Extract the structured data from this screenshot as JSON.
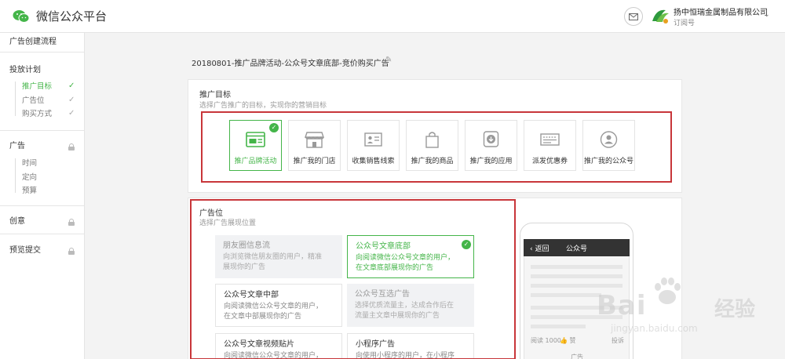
{
  "app": {
    "title": "微信公众平台"
  },
  "account": {
    "name": "扬中恒瑞金属制品有限公司",
    "type": "订阅号"
  },
  "sidebar": {
    "sections": [
      {
        "label": "广告创建流程"
      },
      {
        "label": "投放计划",
        "items": [
          {
            "label": "推广目标",
            "active": true
          },
          {
            "label": "广告位"
          },
          {
            "label": "购买方式"
          }
        ]
      },
      {
        "label": "广告",
        "items": [
          {
            "label": "时间"
          },
          {
            "label": "定向"
          },
          {
            "label": "预算"
          }
        ]
      },
      {
        "label": "创意"
      },
      {
        "label": "预览提交"
      }
    ]
  },
  "plan": {
    "title": "20180801-推广品牌活动-公众号文章底部-竞价购买广告"
  },
  "goal_section": {
    "title": "推广目标",
    "subtitle": "选择广告推广的目标，实现你的营销目标",
    "options": [
      {
        "label": "推广品牌活动",
        "icon": "brand-activity-icon",
        "selected": true
      },
      {
        "label": "推广我的门店",
        "icon": "store-icon"
      },
      {
        "label": "收集销售线索",
        "icon": "contact-card-icon"
      },
      {
        "label": "推广我的商品",
        "icon": "shopping-bag-icon"
      },
      {
        "label": "推广我的应用",
        "icon": "download-app-icon"
      },
      {
        "label": "派发优惠券",
        "icon": "coupon-icon"
      },
      {
        "label": "推广我的公众号",
        "icon": "account-icon"
      }
    ]
  },
  "position_section": {
    "title": "广告位",
    "subtitle": "选择广告展现位置",
    "options": [
      {
        "title": "朋友圈信息流",
        "desc1": "向浏览微信朋友圈的用户，精准",
        "desc2": "展现你的广告",
        "state": "disabled"
      },
      {
        "title": "公众号文章底部",
        "desc1": "向阅读微信公众号文章的用户，",
        "desc2": "在文章底部展现你的广告",
        "state": "selected"
      },
      {
        "title": "公众号文章中部",
        "desc1": "向阅读微信公众号文章的用户，",
        "desc2": "在文章中部展现你的广告",
        "state": "normal"
      },
      {
        "title": "公众号互选广告",
        "desc1": "选择优质流量主，达成合作后在",
        "desc2": "流量主文章中展现你的广告",
        "state": "disabled"
      },
      {
        "title": "公众号文章视频贴片",
        "desc1": "向阅读微信公众号文章的用户，",
        "desc2": "",
        "state": "normal"
      },
      {
        "title": "小程序广告",
        "desc1": "向使用小程序的用户，在小程序",
        "desc2": "",
        "state": "normal"
      }
    ]
  },
  "preview": {
    "back": "返回",
    "title": "公众号",
    "read_count": "阅读 1000",
    "like": "赞",
    "report": "投诉",
    "ad_label": "广告"
  },
  "watermark": {
    "brand": "Bai",
    "name": "经验",
    "url": "jingyan.baidu.com"
  },
  "colors": {
    "accent": "#44b549",
    "highlight": "#c8363a"
  }
}
